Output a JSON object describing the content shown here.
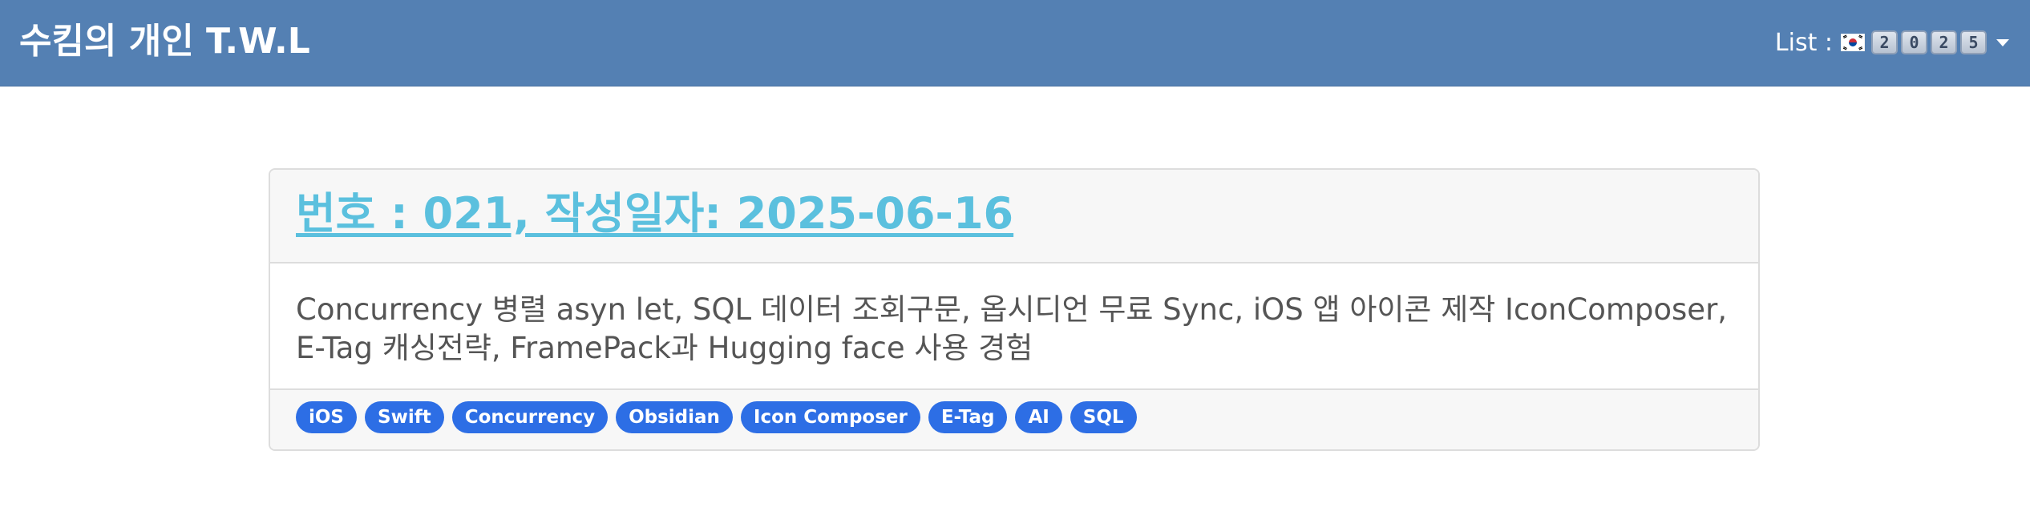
{
  "navbar": {
    "brand": "수킴의 개인 T.W.L",
    "list_label": "List :",
    "flag_icon": "south-korea-flag-icon",
    "year_digits": [
      "2",
      "0",
      "2",
      "5"
    ],
    "accent_color": "#5480b3"
  },
  "post": {
    "title": "번호 : 021, 작성일자: 2025-06-16",
    "description": "Concurrency 병렬 asyn let, SQL 데이터 조회구문, 옵시디언 무료 Sync, iOS 앱 아이콘 제작 IconComposer, E-Tag 캐싱전략, FramePack과 Hugging face 사용 경험",
    "tags": [
      "iOS",
      "Swift",
      "Concurrency",
      "Obsidian",
      "Icon Composer",
      "E-Tag",
      "AI",
      "SQL"
    ],
    "title_color": "#5bc0de",
    "tag_color": "#2d6ee5"
  }
}
